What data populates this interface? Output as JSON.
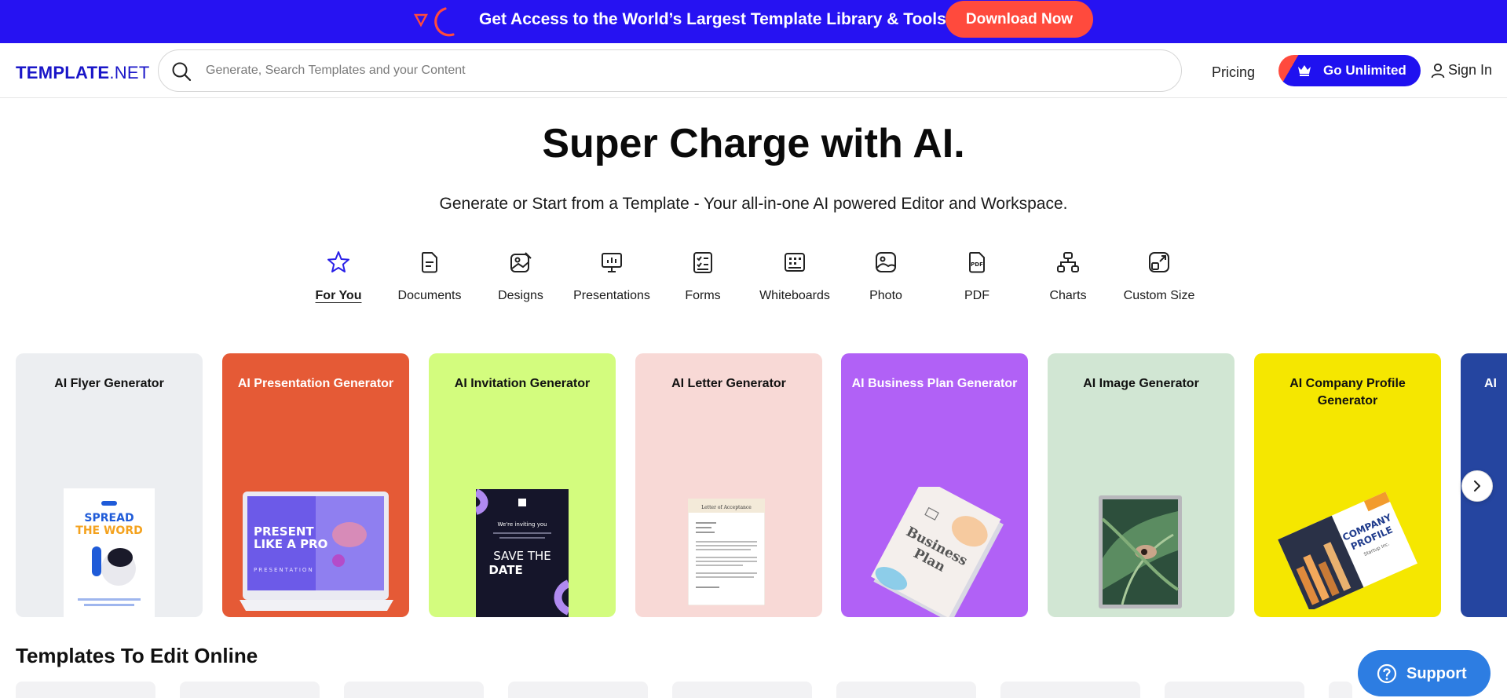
{
  "promo": {
    "text": "Get Access to the World’s Largest Template Library & Tools",
    "button_label": "Download Now",
    "bg_color": "#2612f2",
    "button_color": "#ff4a3d"
  },
  "header": {
    "brand_bold": "TEMPLATE",
    "brand_suffix": ".NET",
    "search_placeholder": "Generate, Search Templates and your Content",
    "search_value": "",
    "pricing_label": "Pricing",
    "unlimited_label": "Go Unlimited",
    "signin_label": "Sign In",
    "brand_color": "#1a16c8"
  },
  "hero": {
    "title": "Super Charge with AI.",
    "subtitle": "Generate or Start from a Template - Your all-in-one AI powered Editor and Workspace."
  },
  "categories": [
    {
      "label": "For You",
      "icon": "star-icon",
      "active": true
    },
    {
      "label": "Documents",
      "icon": "document-icon"
    },
    {
      "label": "Designs",
      "icon": "design-icon"
    },
    {
      "label": "Presentations",
      "icon": "presentation-icon"
    },
    {
      "label": "Forms",
      "icon": "form-icon"
    },
    {
      "label": "Whiteboards",
      "icon": "whiteboard-icon"
    },
    {
      "label": "Photo",
      "icon": "photo-icon"
    },
    {
      "label": "PDF",
      "icon": "pdf-icon"
    },
    {
      "label": "Charts",
      "icon": "chart-icon"
    },
    {
      "label": "Custom Size",
      "icon": "custom-size-icon"
    }
  ],
  "cards": [
    {
      "title": "AI Flyer Generator",
      "bg": "#eceef1",
      "text_color": "#111111",
      "art": {
        "line1": "SPREAD",
        "line2": "THE WORD"
      }
    },
    {
      "title": "AI Presentation Generator",
      "bg": "#e55a36",
      "text_color": "#ffffff",
      "art": {
        "line1": "PRESENT",
        "line2": "LIKE A PRO",
        "line3": "PRESENTATION"
      }
    },
    {
      "title": "AI Invitation Generator",
      "bg": "#d3fc7e",
      "text_color": "#111111",
      "art": {
        "line1": "We're inviting you",
        "line2": "SAVE THE",
        "line3": "DATE"
      }
    },
    {
      "title": "AI Letter Generator",
      "bg": "#f8d9d6",
      "text_color": "#111111",
      "art": {
        "line1": "Letter of Acceptance"
      }
    },
    {
      "title": "AI Business Plan Generator",
      "bg": "#b161f6",
      "text_color": "#ffffff",
      "art": {
        "line1": "Business",
        "line2": "Plan"
      }
    },
    {
      "title": "AI Image Generator",
      "bg": "#d1e6d3",
      "text_color": "#111111",
      "art": {}
    },
    {
      "title": "AI Company Profile Generator",
      "bg": "#f5e700",
      "text_color": "#111111",
      "art": {
        "line1": "COMPANY",
        "line2": "PROFILE",
        "line3": "Startup Inc."
      }
    },
    {
      "title": "AI",
      "bg": "#2545a0",
      "text_color": "#ffffff",
      "art": {}
    }
  ],
  "sections": {
    "templates_title": "Templates To Edit Online"
  },
  "support": {
    "label": "Support",
    "color": "#2d7de2"
  }
}
